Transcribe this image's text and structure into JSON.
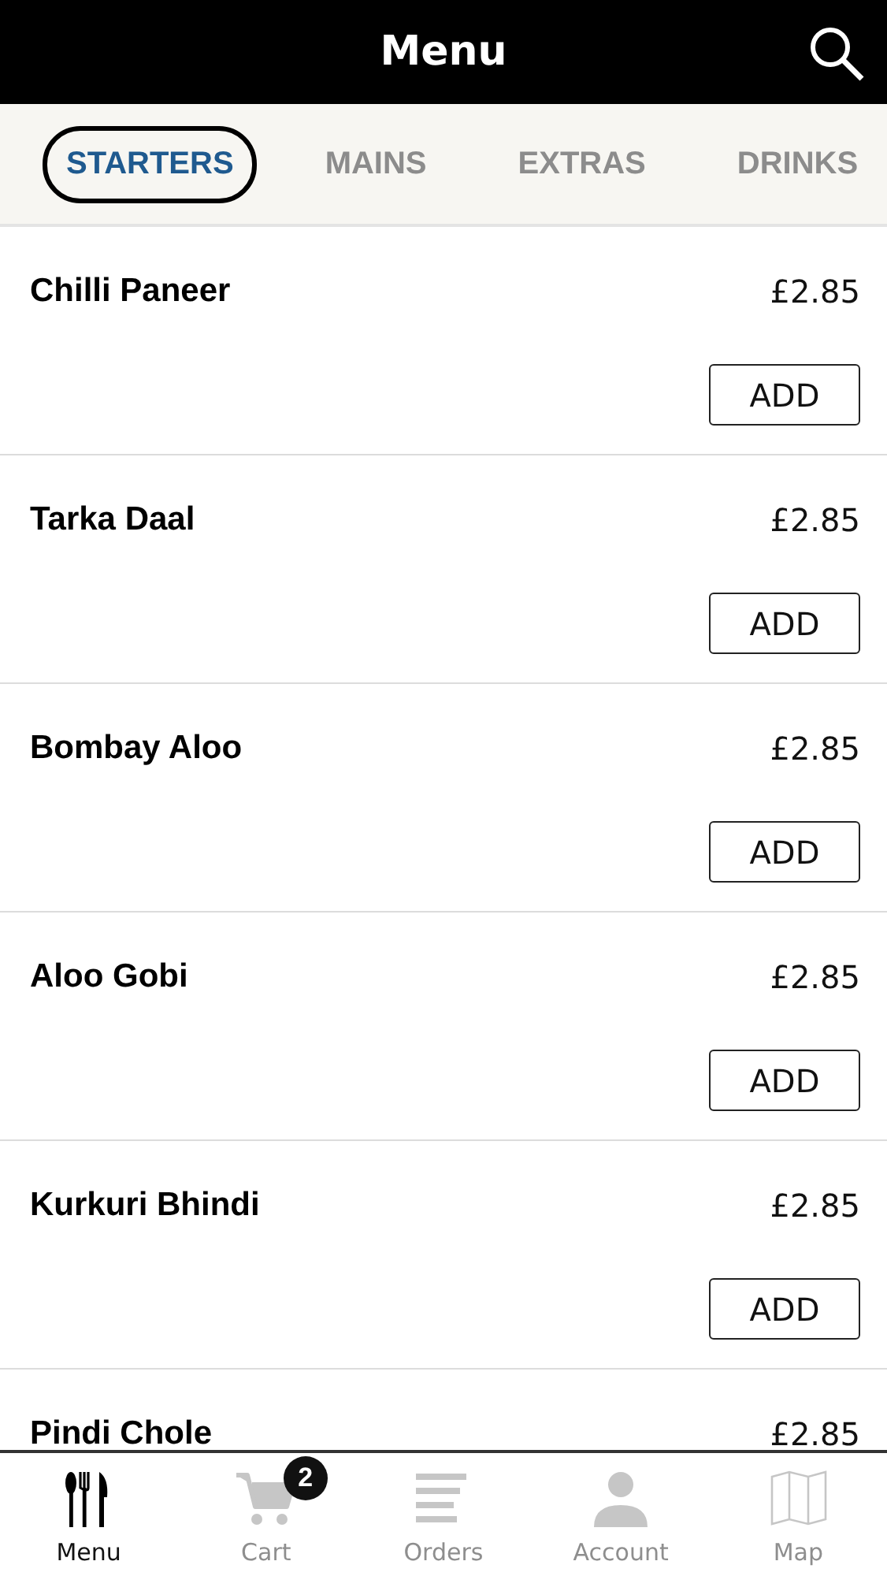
{
  "header": {
    "title": "Menu"
  },
  "tabs": [
    {
      "label": "STARTERS",
      "selected": true
    },
    {
      "label": "MAINS",
      "selected": false
    },
    {
      "label": "EXTRAS",
      "selected": false
    },
    {
      "label": "DRINKS",
      "selected": false
    }
  ],
  "items": [
    {
      "name": "Chilli Paneer",
      "price": "£2.85",
      "button": "ADD"
    },
    {
      "name": "Tarka Daal",
      "price": "£2.85",
      "button": "ADD"
    },
    {
      "name": "Bombay Aloo",
      "price": "£2.85",
      "button": "ADD"
    },
    {
      "name": "Aloo Gobi",
      "price": "£2.85",
      "button": "ADD"
    },
    {
      "name": "Kurkuri Bhindi",
      "price": "£2.85",
      "button": "ADD"
    },
    {
      "name": "Pindi Chole",
      "price": "£2.85"
    }
  ],
  "nav": [
    {
      "kind": "menu",
      "label": "Menu",
      "selected": true
    },
    {
      "kind": "cart",
      "label": "Cart",
      "selected": false,
      "badge": "2"
    },
    {
      "kind": "orders",
      "label": "Orders",
      "selected": false
    },
    {
      "kind": "account",
      "label": "Account",
      "selected": false
    },
    {
      "kind": "map",
      "label": "Map",
      "selected": false
    }
  ]
}
